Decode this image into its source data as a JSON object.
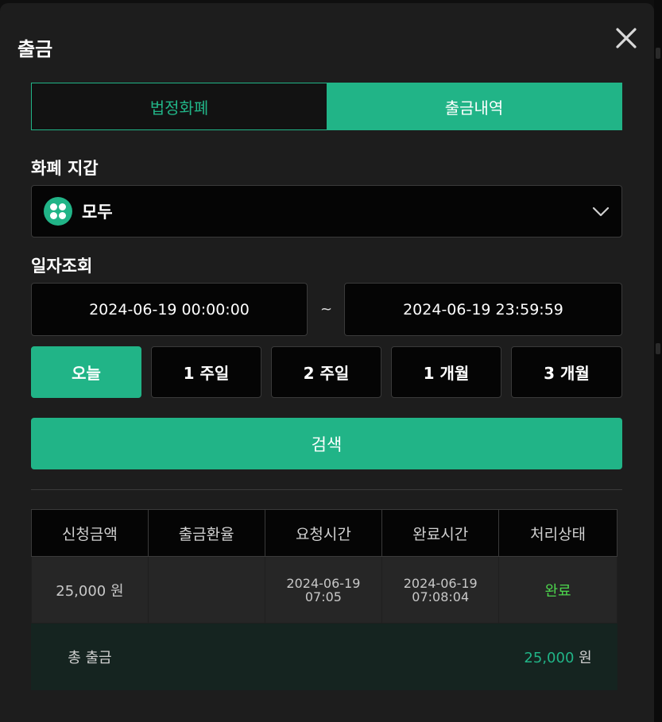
{
  "modal": {
    "title": "출금"
  },
  "tabs": [
    {
      "label": "법정화폐",
      "active": false
    },
    {
      "label": "출금내역",
      "active": true
    }
  ],
  "wallet": {
    "label": "화폐 지갑",
    "selected": "모두",
    "icon": "grid-dots-icon"
  },
  "date": {
    "label": "일자조회",
    "from": "2024-06-19 00:00:00",
    "separator": "~",
    "to": "2024-06-19 23:59:59"
  },
  "quick_ranges": [
    {
      "label": "오늘",
      "active": true
    },
    {
      "label": "1 주일",
      "active": false
    },
    {
      "label": "2 주일",
      "active": false
    },
    {
      "label": "1 개월",
      "active": false
    },
    {
      "label": "3 개월",
      "active": false
    }
  ],
  "search_label": "검색",
  "table": {
    "headers": [
      "신청금액",
      "출금환율",
      "요청시간",
      "완료시간",
      "처리상태"
    ],
    "rows": [
      {
        "amount": "25,000 원",
        "rate": "",
        "request_date": "2024-06-19",
        "request_time": "07:05",
        "complete_date": "2024-06-19",
        "complete_time": "07:08:04",
        "status": "완료"
      }
    ],
    "total": {
      "label": "총 출금",
      "amount": "25,000",
      "unit": "원"
    }
  },
  "colors": {
    "accent": "#21b487",
    "status_done": "#4dd64d",
    "background": "#1d1d1d"
  }
}
